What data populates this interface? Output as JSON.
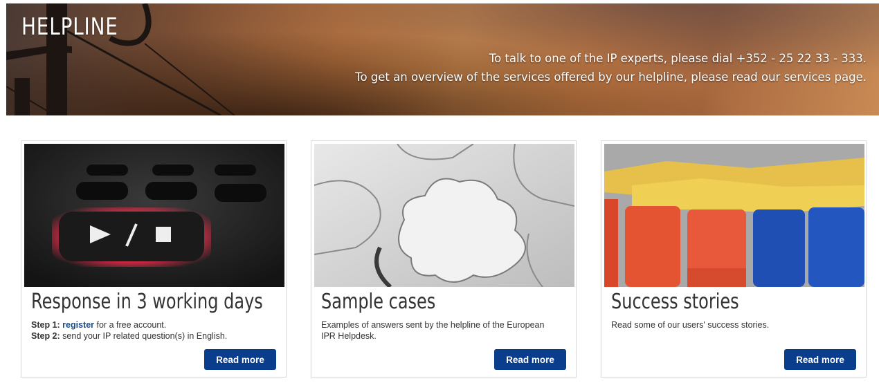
{
  "banner": {
    "title": "HELPLINE",
    "line1": "To talk to one of the IP experts, please dial +352 - 25 22 33 - 333.",
    "line2": "To get an overview of the services offered by our helpline, please read our services page."
  },
  "cards": [
    {
      "title": "Response in 3 working days",
      "step1_label": "Step 1:",
      "step1_link": "register",
      "step1_text": " for a free account.",
      "step2_label": "Step 2:",
      "step2_text": " send your IP related question(s) in English.",
      "button": "Read more"
    },
    {
      "title": "Sample cases",
      "text": "Examples of answers sent by the helpline of the European IPR Helpdesk.",
      "button": "Read more"
    },
    {
      "title": "Success stories",
      "text": "Read some of our users' success stories.",
      "button": "Read more"
    }
  ],
  "colors": {
    "button": "#0a3d8c",
    "link": "#1a4a8a",
    "banner_accent": "#d08a4c"
  }
}
